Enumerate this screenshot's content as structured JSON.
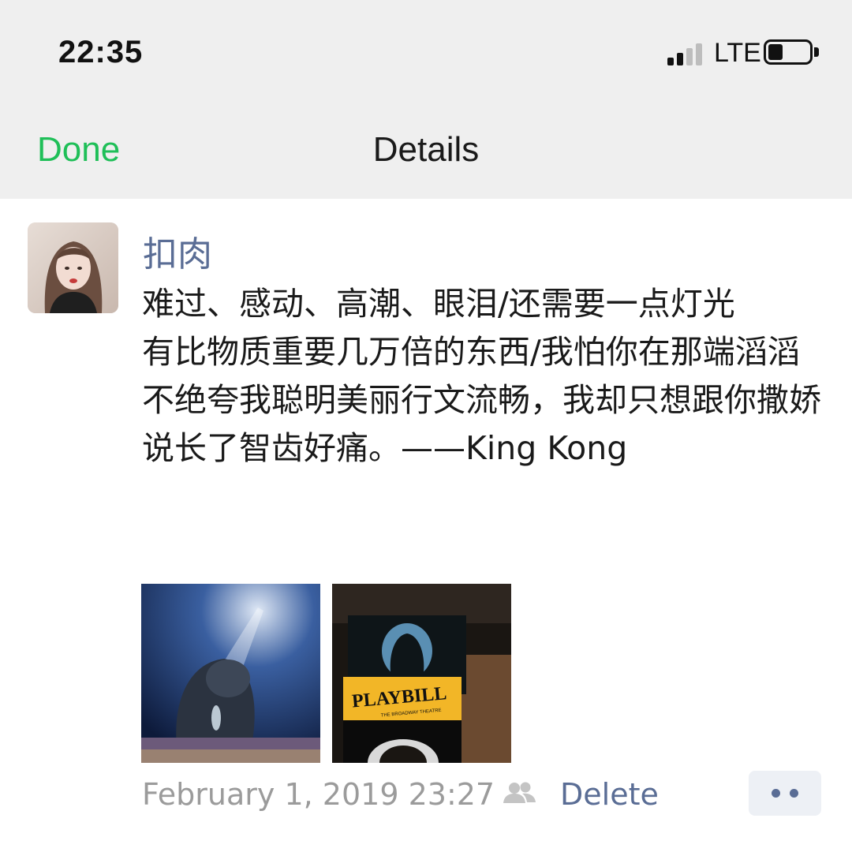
{
  "status_bar": {
    "time": "22:35",
    "network": "LTE",
    "signal_bars": 2,
    "battery_level": 0.35
  },
  "nav": {
    "done_label": "Done",
    "title": "Details"
  },
  "post": {
    "username": "扣肉",
    "text": "难过、感动、高潮、眼泪/还需要一点灯光\n有比物质重要几万倍的东西/我怕你在那端滔滔不绝夸我聪明美丽行文流畅，我却只想跟你撒娇说长了智齿好痛。——King Kong",
    "images": [
      {
        "name": "king-kong-stage-photo",
        "caption": ""
      },
      {
        "name": "playbill-photo",
        "caption": "PLAYBILL",
        "subcaption": "THE BROADWAY THEATRE"
      }
    ],
    "timestamp": "February 1, 2019 23:27",
    "delete_label": "Delete",
    "more_label": "••"
  },
  "colors": {
    "accent_green": "#1fbf58",
    "link_blue": "#5a6d95",
    "nav_background": "#efefef",
    "timestamp_gray": "#9b9b9b"
  },
  "icons": [
    "signal-icon",
    "battery-icon",
    "friends-icon",
    "more-icon"
  ]
}
